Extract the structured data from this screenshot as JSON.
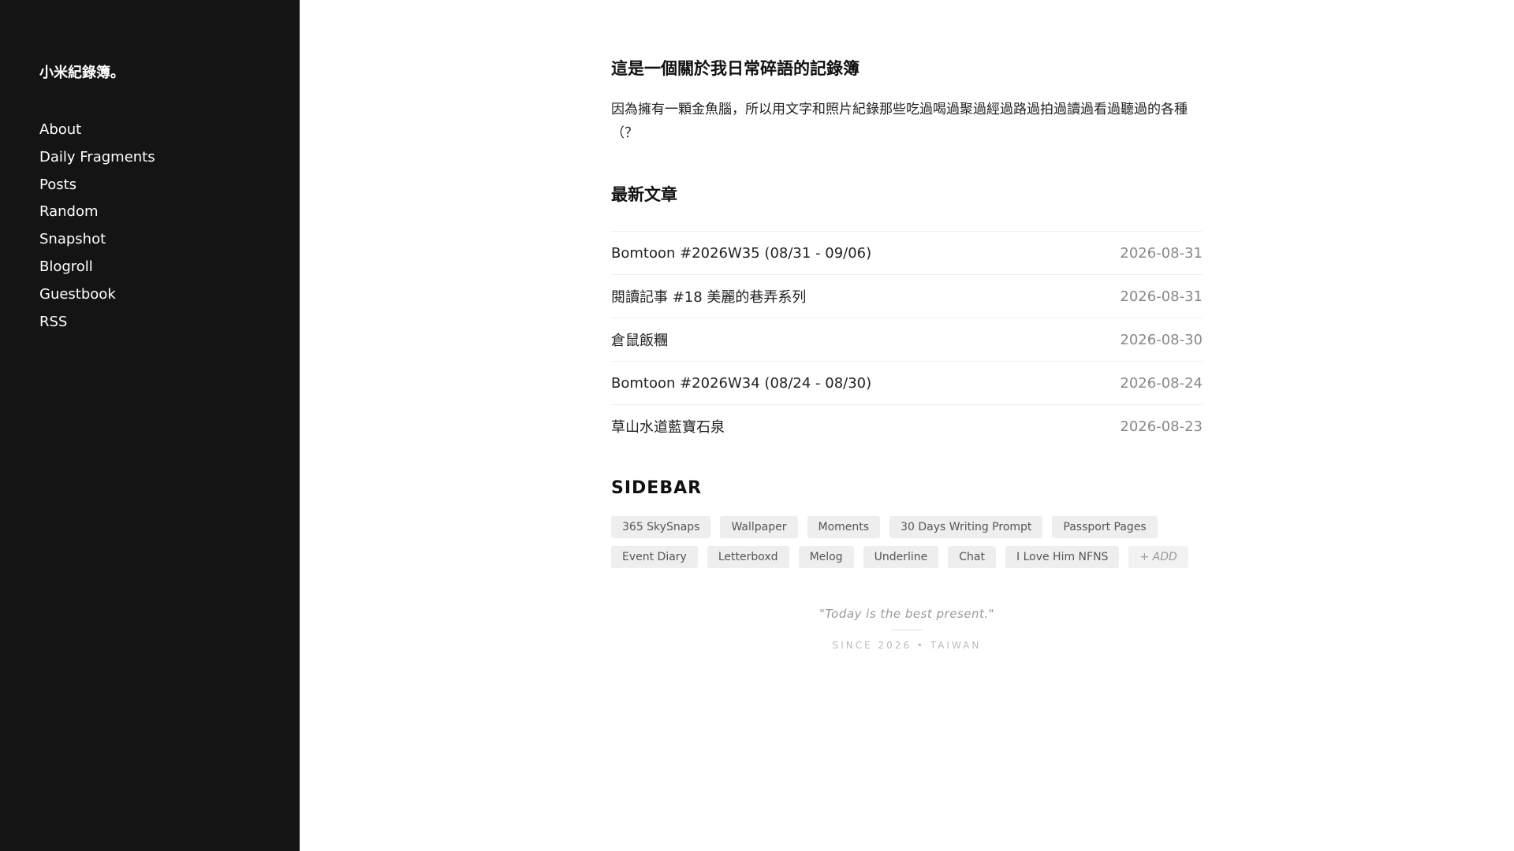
{
  "site": {
    "title": "小米紀錄簿。"
  },
  "nav": {
    "items": [
      {
        "label": "About"
      },
      {
        "label": "Daily Fragments"
      },
      {
        "label": "Posts"
      },
      {
        "label": "Random"
      },
      {
        "label": "Snapshot"
      },
      {
        "label": "Blogroll"
      },
      {
        "label": "Guestbook"
      },
      {
        "label": "RSS"
      }
    ]
  },
  "intro": {
    "title": "這是一個關於我日常碎語的記錄簿",
    "text": "因為擁有一顆金魚腦，所以用文字和照片紀錄那些吃過喝過聚過經過路過拍過讀過看過聽過的各種（？"
  },
  "latest": {
    "title": "最新文章",
    "posts": [
      {
        "title": "Bomtoon #2026W35 (08/31 - 09/06)",
        "date": "2026-08-31"
      },
      {
        "title": "閱讀記事 #18 美麗的巷弄系列",
        "date": "2026-08-31"
      },
      {
        "title": "倉鼠飯糰",
        "date": "2026-08-30"
      },
      {
        "title": "Bomtoon #2026W34 (08/24 - 08/30)",
        "date": "2026-08-24"
      },
      {
        "title": "草山水道藍寶石泉",
        "date": "2026-08-23"
      }
    ]
  },
  "sidebar_section": {
    "title": "SIDEBAR",
    "tags_row1": [
      "365 SkySnaps",
      "Wallpaper",
      "Moments",
      "30 Days Writing Prompt",
      "Passport Pages"
    ],
    "tags_row2": [
      "Event Diary",
      "Letterboxd",
      "Melog",
      "Underline",
      "Chat",
      "I Love Him NFNS"
    ],
    "add_label": "+ ADD"
  },
  "footer": {
    "quote": "\"Today is the best present.\"",
    "since": "SINCE 2026 • TAIWAN"
  },
  "colors": {
    "sidebar_bg": "#141414",
    "tag_bg": "#eeeeee"
  }
}
